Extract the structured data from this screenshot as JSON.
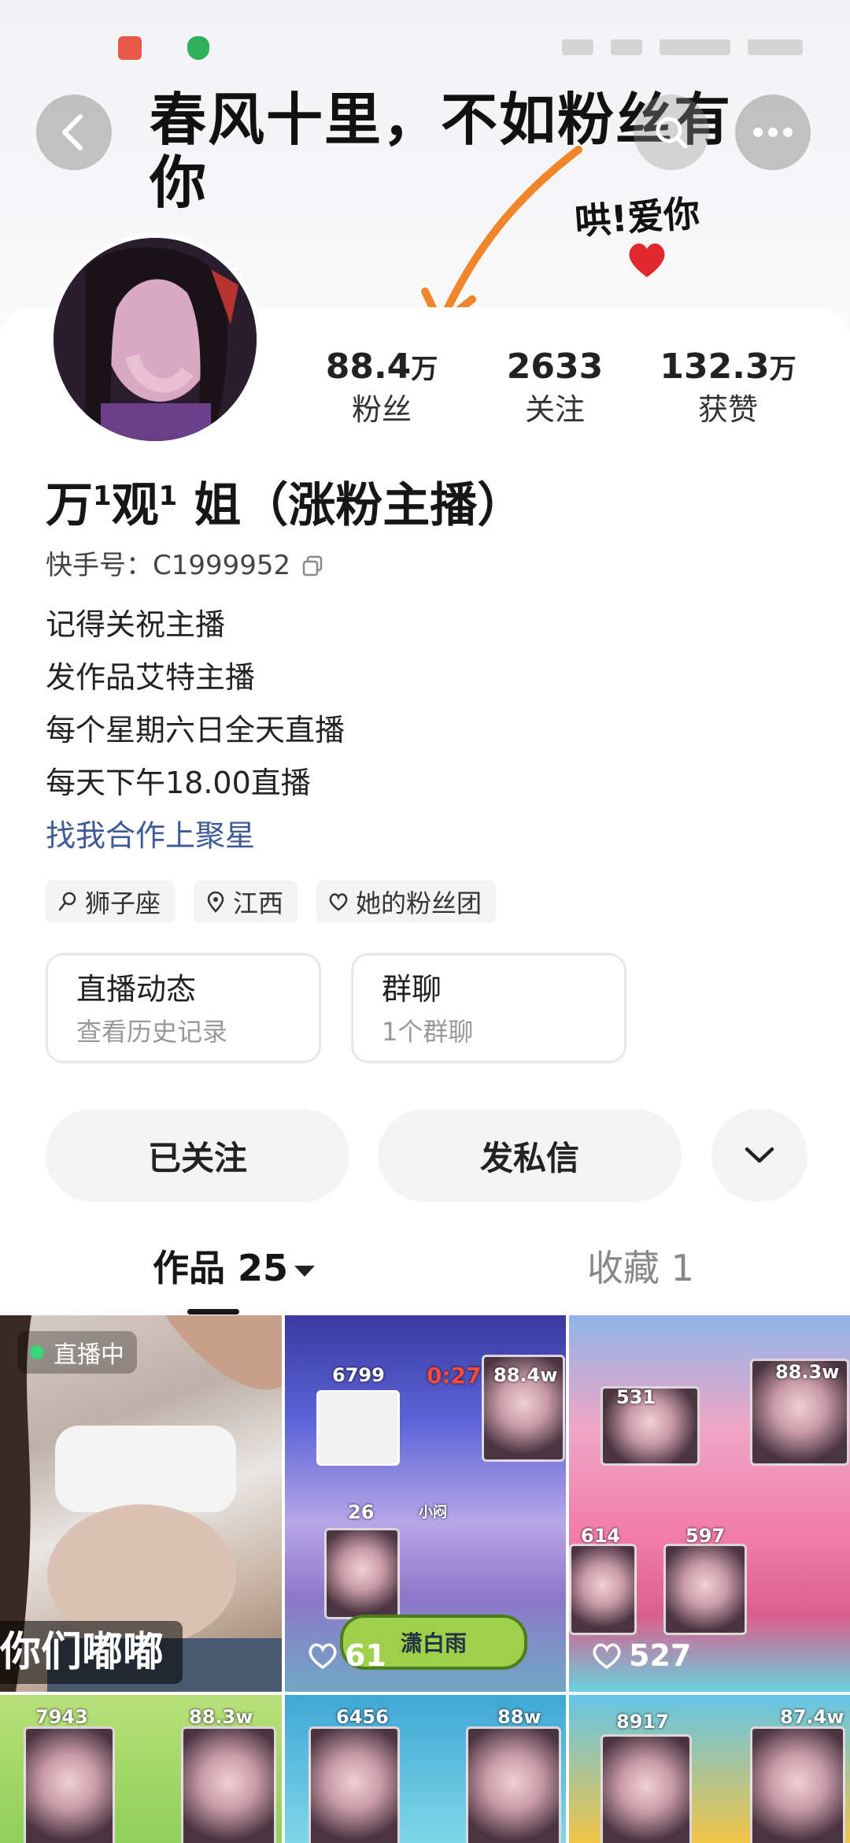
{
  "banner": {
    "headline": "春风十里，不如粉丝有你",
    "sub": "哄!爱你",
    "accent_color": "#f0852a"
  },
  "nav": {
    "back_icon": "chevron-left-icon",
    "search_icon": "search-icon",
    "more_icon": "more-horizontal-icon"
  },
  "profile": {
    "stats": [
      {
        "value": "88.4",
        "unit": "万",
        "label": "粉丝"
      },
      {
        "value": "2633",
        "unit": "",
        "label": "关注"
      },
      {
        "value": "132.3",
        "unit": "万",
        "label": "获赞"
      }
    ],
    "name_parts": [
      "万",
      "1",
      "观",
      "1",
      " 姐（涨粉主播）"
    ],
    "kuaishou_id": "快手号：C1999952",
    "bio": [
      "记得关祝主播",
      "发作品艾特主播",
      "每个星期六日全天直播",
      "每天下午18.00直播"
    ],
    "bio_link": "找我合作上聚星",
    "link_color": "#3e5b97",
    "tags": [
      {
        "icon": "zodiac-leo-icon",
        "label": "狮子座"
      },
      {
        "icon": "location-pin-icon",
        "label": "江西"
      },
      {
        "icon": "fan-group-heart-icon",
        "label": "她的粉丝团"
      }
    ],
    "cards": [
      {
        "title": "直播动态",
        "sub": "查看历史记录"
      },
      {
        "title": "群聊",
        "sub": "1个群聊"
      }
    ],
    "actions": {
      "follow": "已关注",
      "message": "发私信",
      "expand_icon": "chevron-down-icon"
    }
  },
  "tabs": {
    "works": "作品 25",
    "favorites": "收藏 1"
  },
  "grid": {
    "live_badge": "直播中",
    "live_caption": "你们嘟嘟",
    "live_dot_color": "#3ad47a",
    "cells": [
      {
        "likes": "",
        "overlays": []
      },
      {
        "likes": "61",
        "overlays": [
          "6799",
          "88.4w",
          "0:27",
          "26",
          "小闷",
          "潇白雨"
        ]
      },
      {
        "likes": "527",
        "overlays": [
          "531",
          "88.3w",
          "614",
          "597"
        ]
      },
      {
        "likes": "",
        "overlays": [
          "7943",
          "88.3w"
        ]
      },
      {
        "likes": "",
        "overlays": [
          "6456",
          "88w"
        ]
      },
      {
        "likes": "",
        "overlays": [
          "8917",
          "87.4w"
        ]
      }
    ]
  }
}
